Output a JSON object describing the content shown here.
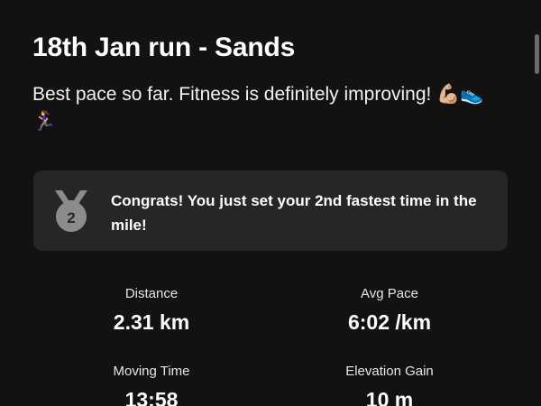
{
  "activity": {
    "title": "18th Jan run - Sands",
    "description": "Best pace so far. Fitness is definitely improving! 💪🏼👟🏃‍♀️"
  },
  "achievement": {
    "icon": "medal-2-icon",
    "rank": "2",
    "text": "Congrats! You just set your 2nd fastest time in the mile!"
  },
  "stats": [
    {
      "label": "Distance",
      "value": "2.31 km"
    },
    {
      "label": "Avg Pace",
      "value": "6:02 /km"
    },
    {
      "label": "Moving Time",
      "value": "13:58"
    },
    {
      "label": "Elevation Gain",
      "value": "10 m"
    }
  ],
  "colors": {
    "background": "#121212",
    "card": "#262626",
    "medal": "#8c8c8c",
    "text": "#ffffff"
  }
}
